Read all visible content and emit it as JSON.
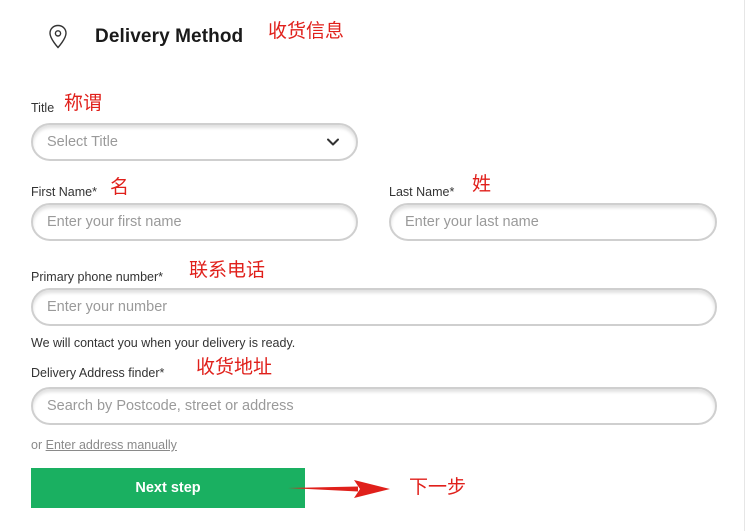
{
  "header": {
    "title": "Delivery Method",
    "annotation": "收货信息",
    "icon": "location-pin-icon"
  },
  "title_field": {
    "label": "Title",
    "annotation": "称谓",
    "placeholder": "Select Title",
    "icon": "chevron-down-icon"
  },
  "first_name": {
    "label": "First Name*",
    "annotation": "名",
    "placeholder": "Enter your first name"
  },
  "last_name": {
    "label": "Last Name*",
    "annotation": "姓",
    "placeholder": "Enter your last name"
  },
  "phone": {
    "label": "Primary phone number*",
    "annotation": "联系电话",
    "placeholder": "Enter your number",
    "helper": "We will contact you when your delivery is ready."
  },
  "address": {
    "label": "Delivery Address finder*",
    "annotation": "收货地址",
    "placeholder": "Search by Postcode, street or address",
    "or_text": "or",
    "manual_link": "Enter address manually"
  },
  "next": {
    "label": "Next step",
    "annotation": "下一步"
  },
  "colors": {
    "accent_green": "#1ab061",
    "annotation_red": "#e0201b"
  }
}
